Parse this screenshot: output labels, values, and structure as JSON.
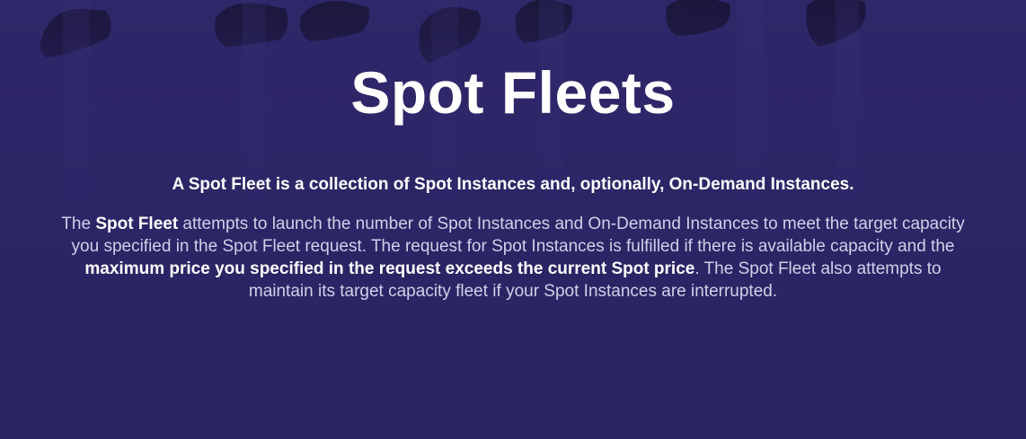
{
  "slide": {
    "title": "Spot Fleets",
    "subtitle": "A Spot Fleet is a collection of Spot Instances and, optionally, On-Demand Instances.",
    "paragraph": {
      "seg1": "The ",
      "seg2_bold": "Spot Fleet",
      "seg3": " attempts to launch the number of Spot Instances and On-Demand Instances to meet the target capacity you specified in the Spot Fleet request. The request for Spot Instances is fulfilled if there is available capacity and the ",
      "seg4_bold": "maximum price you specified in the request exceeds the current Spot price",
      "seg5": ". The Spot Fleet also attempts to maintain its target capacity fleet if your Spot Instances are interrupted."
    }
  },
  "colors": {
    "background": "#2b2565",
    "text_primary": "#ffffff",
    "text_secondary": "#d2cfe8"
  }
}
